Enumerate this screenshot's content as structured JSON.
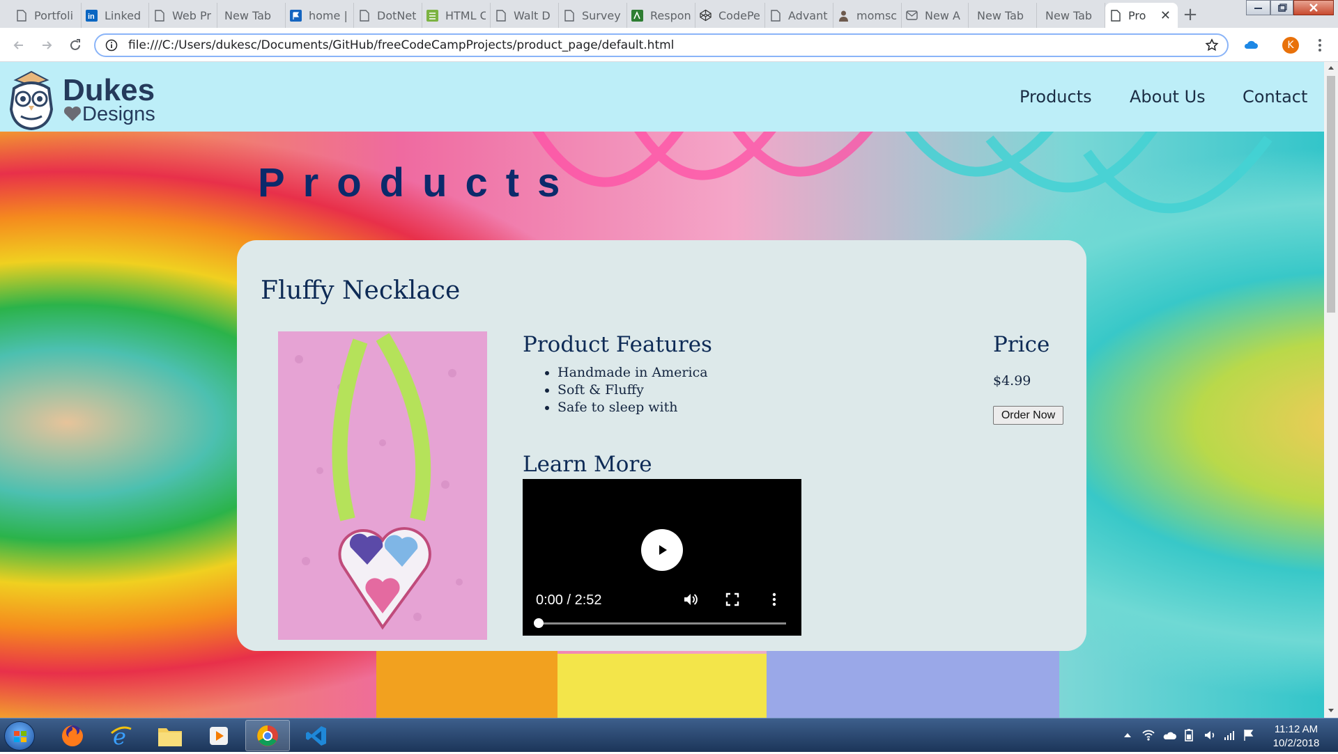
{
  "browser": {
    "tabs": [
      {
        "label": "Portfoli",
        "icon": "page-icon"
      },
      {
        "label": "Linked",
        "icon": "linkedin-icon"
      },
      {
        "label": "Web Pr",
        "icon": "page-icon"
      },
      {
        "label": "New Tab",
        "icon": ""
      },
      {
        "label": "home |",
        "icon": "flag-icon"
      },
      {
        "label": "DotNet",
        "icon": "page-icon"
      },
      {
        "label": "HTML C",
        "icon": "sheet-icon"
      },
      {
        "label": "Walt D",
        "icon": "page-icon"
      },
      {
        "label": "Survey",
        "icon": "page-icon"
      },
      {
        "label": "Respon",
        "icon": "sheet-icon"
      },
      {
        "label": "CodePe",
        "icon": "codepen-icon"
      },
      {
        "label": "Advant",
        "icon": "page-icon"
      },
      {
        "label": "momsc",
        "icon": "person-icon"
      },
      {
        "label": "New A",
        "icon": "mail-icon"
      },
      {
        "label": "New Tab",
        "icon": ""
      },
      {
        "label": "New Tab",
        "icon": ""
      },
      {
        "label": "Pro",
        "icon": "page-icon"
      }
    ],
    "new_tab_symbol": "+",
    "close_symbol": "✕",
    "url": "file:///C:/Users/dukesc/Documents/GitHub/freeCodeCampProjects/product_page/default.html",
    "profile_initial": "K"
  },
  "site": {
    "brand_name": "Dukes",
    "brand_sub": "Designs",
    "nav": [
      "Products",
      "About Us",
      "Contact"
    ],
    "page_title": "Products"
  },
  "product": {
    "name": "Fluffy Necklace",
    "features_heading": "Product Features",
    "features": [
      "Handmade in America",
      "Soft & Fluffy",
      "Safe to sleep with"
    ],
    "learn_heading": "Learn More",
    "video_time": "0:00 / 2:52",
    "price_heading": "Price",
    "price": "$4.99",
    "order_label": "Order Now"
  },
  "taskbar": {
    "time": "11:12 AM",
    "date": "10/2/2018"
  },
  "colors": {
    "header_bg": "#bdeef8",
    "card_bg": "#dde9ea",
    "heading": "#0d2a55",
    "title": "#0b2a6b"
  }
}
